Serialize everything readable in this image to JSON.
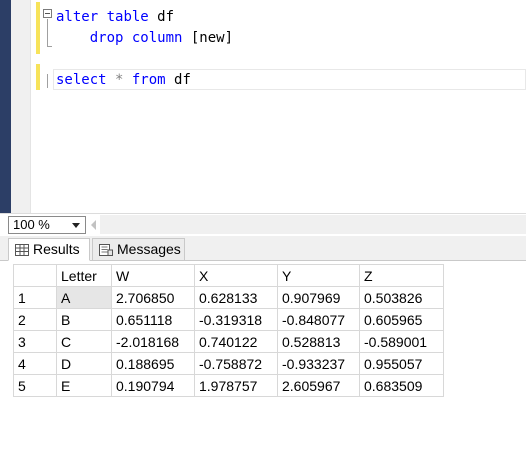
{
  "editor": {
    "lines": [
      {
        "kw1": "alter",
        "sp1": " ",
        "kw2": "table",
        "rest": " df"
      },
      {
        "indent": "    ",
        "kw1": "drop",
        "sp1": " ",
        "kw2": "column",
        "rest": " [new]"
      },
      {
        "kw1": "select",
        "op": " * ",
        "kw2": "from",
        "rest": " df"
      }
    ]
  },
  "zoom": {
    "value": "100 %"
  },
  "tabs": {
    "results": "Results",
    "messages": "Messages"
  },
  "grid": {
    "columns": [
      "Letter",
      "W",
      "X",
      "Y",
      "Z"
    ],
    "rows": [
      {
        "num": "1",
        "cells": [
          "A",
          "2.706850",
          "0.628133",
          "0.907969",
          "0.503826"
        ]
      },
      {
        "num": "2",
        "cells": [
          "B",
          "0.651118",
          "-0.319318",
          "-0.848077",
          "0.605965"
        ]
      },
      {
        "num": "3",
        "cells": [
          "C",
          "-2.018168",
          "0.740122",
          "0.528813",
          "-0.589001"
        ]
      },
      {
        "num": "4",
        "cells": [
          "D",
          "0.188695",
          "-0.758872",
          "-0.933237",
          "0.955057"
        ]
      },
      {
        "num": "5",
        "cells": [
          "E",
          "0.190794",
          "1.978757",
          "2.605967",
          "0.683509"
        ]
      }
    ]
  },
  "colors": {
    "keyword": "#0000ff",
    "operator": "#808080",
    "left_strip": "#2c3e66",
    "change_marker": "#f7e35a"
  },
  "icons": {
    "results_tab": "grid-icon",
    "messages_tab": "messages-icon",
    "zoom": "chevron-down-icon"
  }
}
